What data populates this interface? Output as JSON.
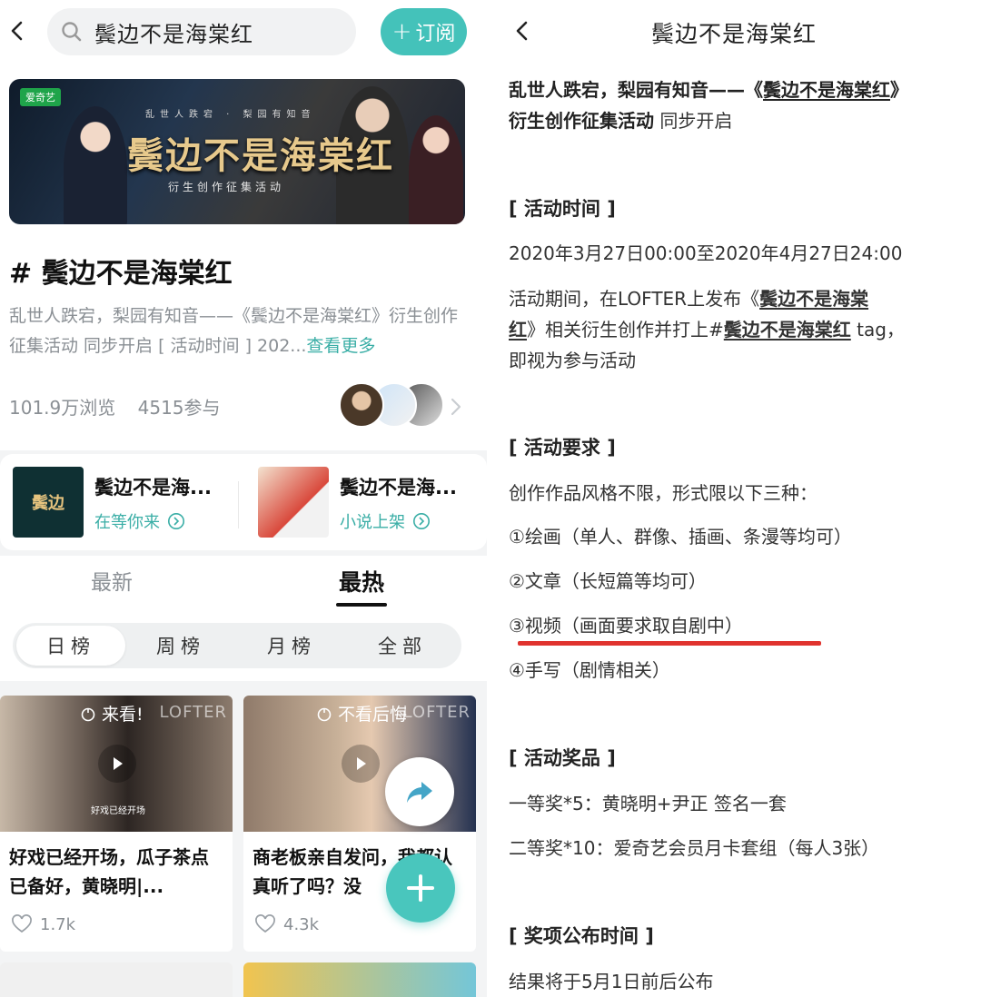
{
  "left": {
    "search": {
      "query": "鬓边不是海棠红"
    },
    "subscribe_label": "订阅",
    "subscribe_plus": "+",
    "banner": {
      "logo": "爱奇艺",
      "kicker": "乱世人跌宕 · 梨园有知音",
      "title": "鬓边不是海棠红",
      "subtitle": "衍生创作征集活动"
    },
    "tag_title": "# 鬓边不是海棠红",
    "description": "乱世人跌宕，梨园有知音——《鬓边不是海棠红》衍生创作征集活动 同步开启 [ 活动时间 ] 202...",
    "more_label": "查看更多",
    "views": "101.9万浏览",
    "participants": "4515参与",
    "cards": [
      {
        "title": "鬓边不是海...",
        "sub": "在等你来",
        "thumb_text": "鬓边"
      },
      {
        "title": "鬓边不是海...",
        "sub": "小说上架"
      }
    ],
    "tabs": {
      "latest": "最新",
      "hot": "最热"
    },
    "segments": [
      "日榜",
      "周榜",
      "月榜",
      "全部"
    ],
    "posts": [
      {
        "badge": "来看!",
        "watermark": "LOFTER",
        "caption": "好戏已经开场",
        "title": "好戏已经开场，瓜子茶点已备好，黄晓明|...",
        "likes": "1.7k"
      },
      {
        "badge": "不看后悔",
        "watermark": "LOFTER",
        "caption": "",
        "title": "商老板亲自发问，我都认真听了吗？没",
        "likes": "4.3k"
      }
    ]
  },
  "right": {
    "title": "鬓边不是海棠红",
    "intro_prefix": "乱世人跌宕，梨园有知音——《",
    "intro_link": "鬓边不是海棠红",
    "intro_suffix": "》",
    "intro_line2_bold": "衍生创作征集活动",
    "intro_line2_rest": " 同步开启",
    "sec_time": "[ 活动时间 ]",
    "time_value": "2020年3月27日00:00至2020年4月27日24:00",
    "time_desc_a": "活动期间，在LOFTER上发布《",
    "time_desc_link1a": "鬓边不是海棠",
    "time_desc_link1b": "红",
    "time_desc_b": "》相关衍生创作并打上#",
    "time_desc_link2": "鬓边不是海棠红",
    "time_desc_c": " tag，",
    "time_desc_d": "即视为参与活动",
    "sec_req": "[ 活动要求 ]",
    "req_intro": "创作作品风格不限，形式限以下三种：",
    "req_items": [
      "①绘画（单人、群像、插画、条漫等均可）",
      "②文章（长短篇等均可）",
      "③视频（画面要求取自剧中）",
      "④手写（剧情相关）"
    ],
    "sec_prize": "[ 活动奖品 ]",
    "prizes": [
      "一等奖*5：黄晓明+尹正 签名一套",
      "二等奖*10：爱奇艺会员月卡套组（每人3张）"
    ],
    "sec_announce": "[ 奖项公布时间 ]",
    "announce": "结果将于5月1日前后公布"
  },
  "colors": {
    "accent": "#44c2ba",
    "highlight_red": "#e0332e"
  },
  "icons": [
    "back-icon",
    "search-icon",
    "chevron-right-icon",
    "circle-arrow-icon",
    "fire-icon",
    "play-icon",
    "heart-icon",
    "share-icon",
    "plus-icon"
  ]
}
